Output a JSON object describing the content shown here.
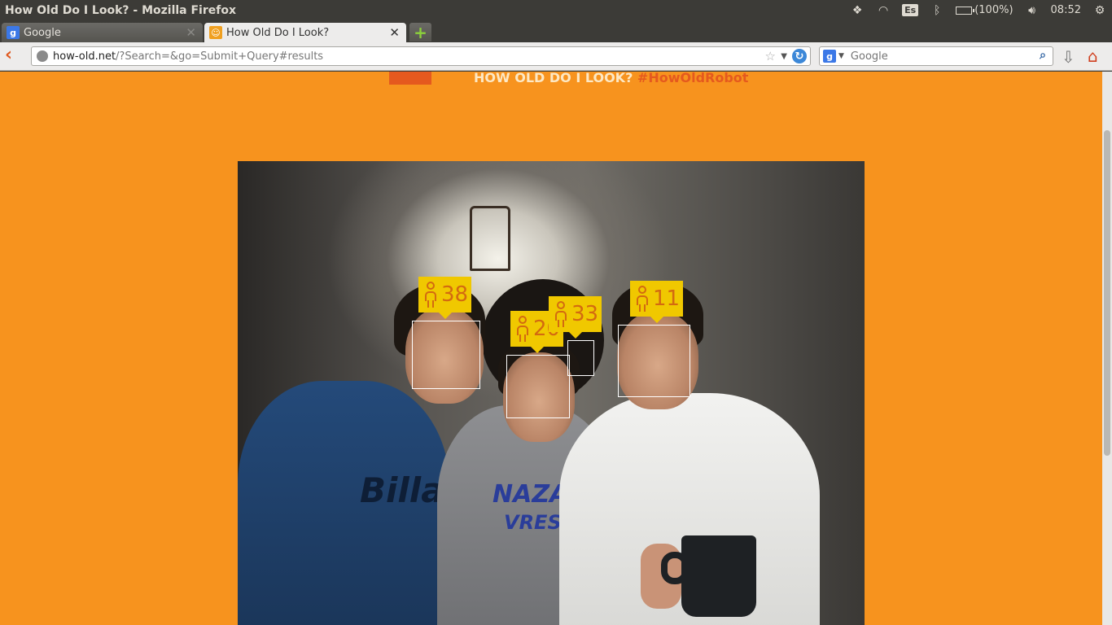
{
  "window": {
    "title": "How Old Do I Look? - Mozilla Firefox"
  },
  "tray": {
    "keyboard_layout": "Es",
    "battery": "(100%)",
    "clock": "08:52"
  },
  "tabs": [
    {
      "label": "Google",
      "icon": "google-favicon",
      "active": false
    },
    {
      "label": "How Old Do I Look?",
      "icon": "how-old-favicon",
      "active": true
    }
  ],
  "navbar": {
    "url_host": "how-old.net",
    "url_path": "/?Search=&go=Submit+Query#results",
    "search_placeholder": "Google"
  },
  "page": {
    "headline": "HOW OLD DO I LOOK?",
    "hashtag": "#HowOldRobot",
    "background_color": "#f7931e",
    "tag_color": "#f0c800"
  },
  "faces": [
    {
      "age": "38",
      "gender": "male-icon"
    },
    {
      "age": "20",
      "gender": "male-icon"
    },
    {
      "age": "33",
      "gender": "male-icon"
    },
    {
      "age": "11",
      "gender": "male-icon"
    }
  ],
  "shirt_texts": {
    "blue": "Billa",
    "grey_line1": "NAZARET",
    "grey_line2": "VRESTL"
  }
}
